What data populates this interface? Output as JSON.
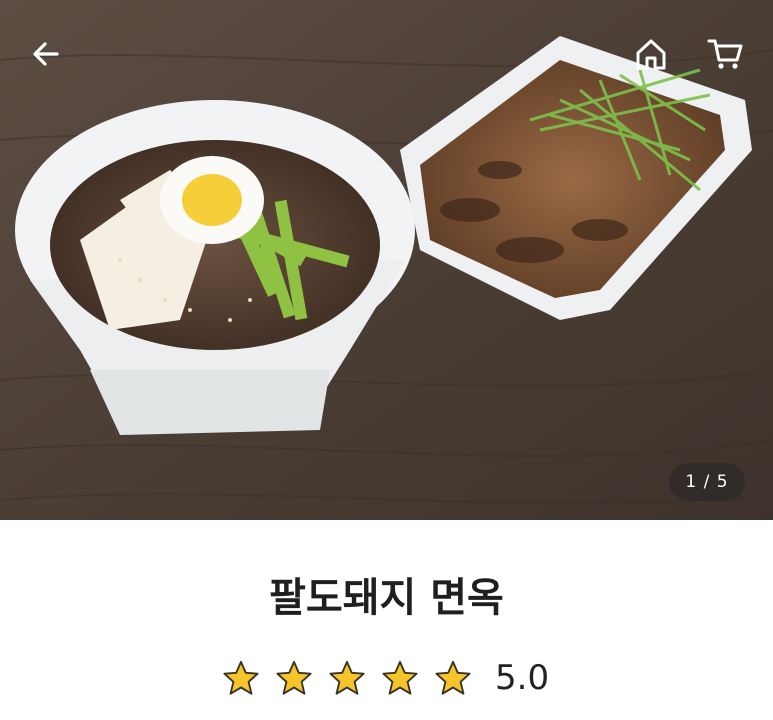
{
  "header": {
    "back_icon": "arrow-left-icon",
    "home_icon": "home-icon",
    "cart_icon": "cart-icon"
  },
  "gallery": {
    "counter_text": "1 / 5",
    "current_index": 1,
    "total": 5
  },
  "product": {
    "name": "팔도돼지 면옥",
    "rating_value": "5.0",
    "stars_filled": 5,
    "stars_total": 5
  },
  "colors": {
    "star": "#f6c52c",
    "star_outline": "#3b3322",
    "title": "#1f1f1f"
  }
}
